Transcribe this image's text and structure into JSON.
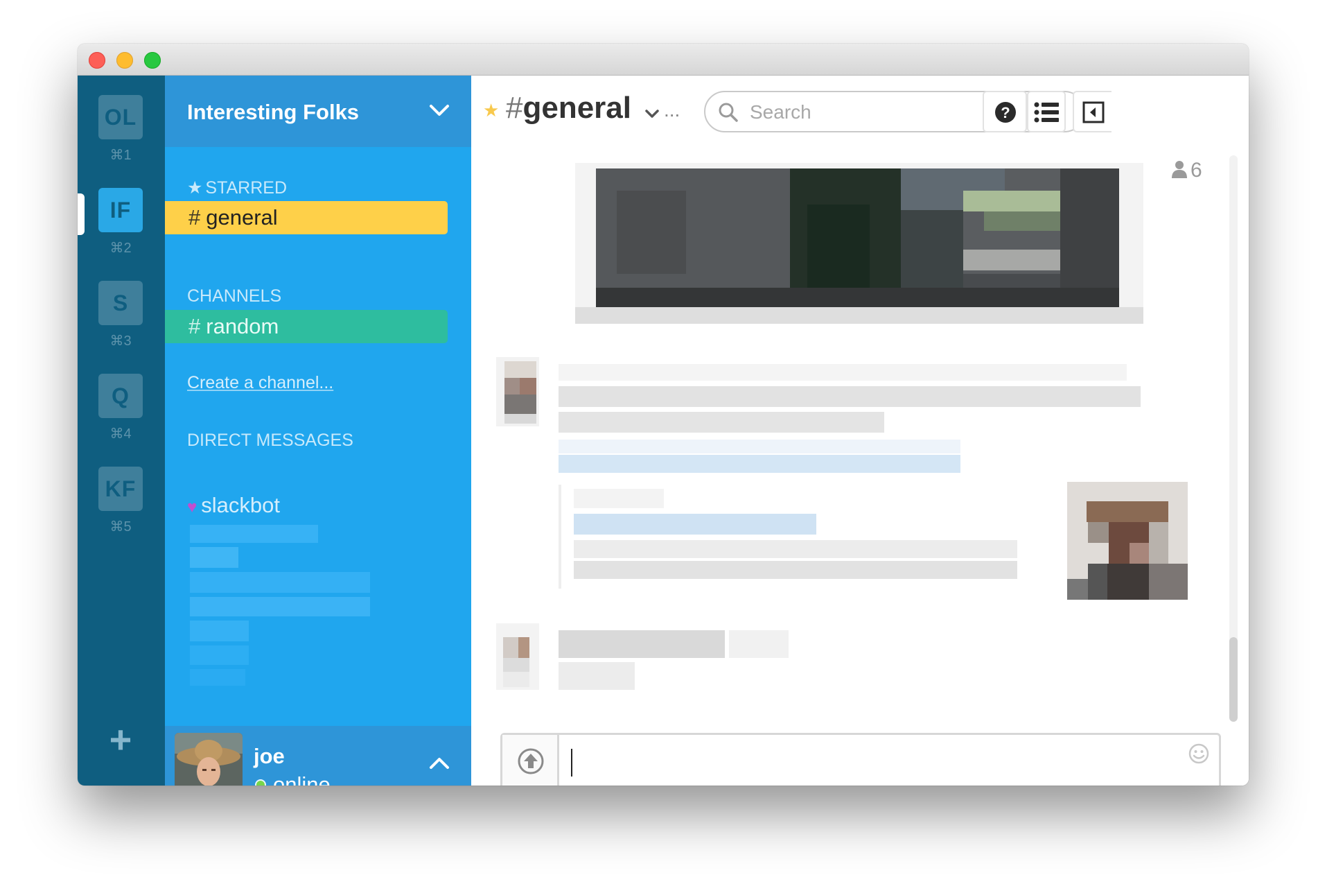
{
  "teams": [
    {
      "initials": "OL",
      "shortcut": "⌘1",
      "active": false
    },
    {
      "initials": "IF",
      "shortcut": "⌘2",
      "active": true
    },
    {
      "initials": "S",
      "shortcut": "⌘3",
      "active": false
    },
    {
      "initials": "Q",
      "shortcut": "⌘4",
      "active": false
    },
    {
      "initials": "KF",
      "shortcut": "⌘5",
      "active": false
    }
  ],
  "add_team_label": "+",
  "sidebar": {
    "team_name": "Interesting Folks",
    "starred_label": "STARRED",
    "starred_channels": [
      {
        "hash": "#",
        "name": "general"
      }
    ],
    "channels_label": "CHANNELS",
    "channels": [
      {
        "hash": "#",
        "name": "random"
      }
    ],
    "create_channel": "Create a channel...",
    "dm_label": "DIRECT MESSAGES",
    "dms": [
      {
        "name": "slackbot"
      }
    ]
  },
  "user": {
    "name": "joe",
    "status": "online"
  },
  "header": {
    "hash": "#",
    "channel_name": "general",
    "ellipsis": "...",
    "search_placeholder": "Search",
    "member_count": "6"
  },
  "composer": {
    "value": ""
  },
  "colors": {
    "teambar": "#0f5e80",
    "sidebar": "#20a6ee",
    "sidebar_header": "#2e95d8",
    "active_channel": "#fed049",
    "hover_channel": "#2ebd9f",
    "presence_online": "#78d64b"
  }
}
